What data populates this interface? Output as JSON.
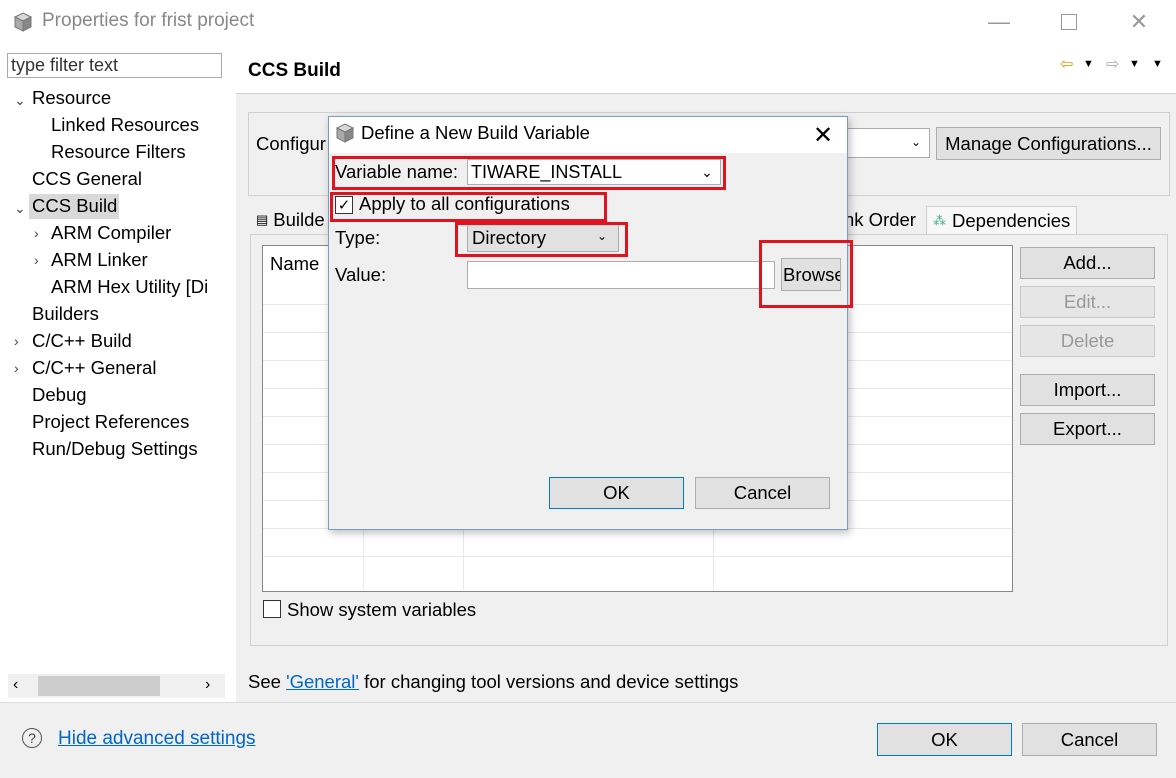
{
  "window": {
    "title": "Properties for frist project"
  },
  "sidebar": {
    "filter_placeholder": "type filter text",
    "items": [
      {
        "label": "Resource"
      },
      {
        "label": "Linked Resources"
      },
      {
        "label": "Resource Filters"
      },
      {
        "label": "CCS General"
      },
      {
        "label": "CCS Build"
      },
      {
        "label": "ARM Compiler"
      },
      {
        "label": "ARM Linker"
      },
      {
        "label": "ARM Hex Utility  [Di"
      },
      {
        "label": "Builders"
      },
      {
        "label": "C/C++ Build"
      },
      {
        "label": "C/C++ General"
      },
      {
        "label": "Debug"
      },
      {
        "label": "Project References"
      },
      {
        "label": "Run/Debug Settings"
      }
    ]
  },
  "main": {
    "page_title": "CCS Build",
    "config_label": "Configur",
    "manage_configs": "Manage Configurations...",
    "tabs": [
      {
        "label": "Builde"
      },
      {
        "label": "nk Order"
      },
      {
        "label": "Dependencies"
      }
    ],
    "table_col_name": "Name",
    "buttons": {
      "add": "Add...",
      "edit": "Edit...",
      "delete": "Delete",
      "import": "Import...",
      "export": "Export..."
    },
    "show_system_vars": "Show system variables",
    "see_prefix": "See ",
    "see_link": "'General'",
    "see_suffix": " for changing tool versions and device settings"
  },
  "footer": {
    "hide_advanced": "Hide advanced settings",
    "ok": "OK",
    "cancel": "Cancel"
  },
  "dialog": {
    "title": "Define a New Build Variable",
    "variable_name_label": "Variable name:",
    "variable_name_value": "TIWARE_INSTALL",
    "apply_all_label": "Apply to all configurations",
    "apply_all_checked": true,
    "type_label": "Type:",
    "type_value": "Directory",
    "value_label": "Value:",
    "value_value": "",
    "browse": "Browse",
    "ok": "OK",
    "cancel": "Cancel"
  },
  "colors": {
    "highlight_box": "#e0141e",
    "link": "#0066cc",
    "default_button_border": "#0078d7"
  }
}
